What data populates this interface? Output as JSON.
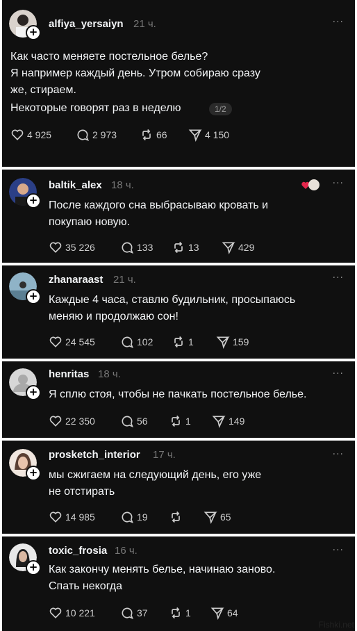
{
  "posts": [
    {
      "username": "alfiya_yersaiyn",
      "time": "21 ч.",
      "lines": [
        "Как часто меняете постельное белье?",
        "Я например каждый день. Утром собираю сразу",
        "же, стираем.",
        "Некоторые говорят раз в неделю"
      ],
      "pager": "1/2",
      "likes": "4 925",
      "comments": "2 973",
      "reposts": "66",
      "shares": "4 150",
      "avatar_color": "#d9d2cc"
    },
    {
      "username": "baltik_alex",
      "time": "18 ч.",
      "lines": [
        "После каждого сна выбрасываю кровать и",
        "покупаю новую."
      ],
      "likes": "35 226",
      "comments": "133",
      "reposts": "13",
      "shares": "429",
      "avatar_color": "#2b3f86"
    },
    {
      "username": "zhanaraast",
      "time": "21 ч.",
      "lines": [
        "Каждые 4 часа, ставлю будильник, просыпаюсь",
        "меняю и продолжаю сон!"
      ],
      "likes": "24 545",
      "comments": "102",
      "reposts": "1",
      "shares": "159",
      "avatar_color": "#8fb3c7"
    },
    {
      "username": "henritas",
      "time": "18 ч.",
      "lines": [
        "Я сплю стоя, чтобы не пачкать постельное белье."
      ],
      "likes": "22 350",
      "comments": "56",
      "reposts": "1",
      "shares": "149",
      "avatar_color": "#d7d7d7"
    },
    {
      "username": "prosketch_interior",
      "time": "17 ч.",
      "lines": [
        "мы сжигаем на следующий день, его уже",
        "не отстирать"
      ],
      "likes": "14 985",
      "comments": "19",
      "reposts": "",
      "shares": "65",
      "avatar_color": "#cda88f"
    },
    {
      "username": "toxic_frosia",
      "time": "16 ч.",
      "lines": [
        "Как закончу менять белье, начинаю заново.",
        "Спать некогда"
      ],
      "likes": "10 221",
      "comments": "37",
      "reposts": "1",
      "shares": "64",
      "avatar_color": "#e8e8e8"
    }
  ],
  "icons": {
    "like": "heart-icon",
    "comment": "comment-icon",
    "repost": "repost-icon",
    "share": "send-icon",
    "more": "more-icon",
    "follow": "plus-icon"
  },
  "more_label": "···",
  "plus_label": "+",
  "watermark": "Fishki.net"
}
